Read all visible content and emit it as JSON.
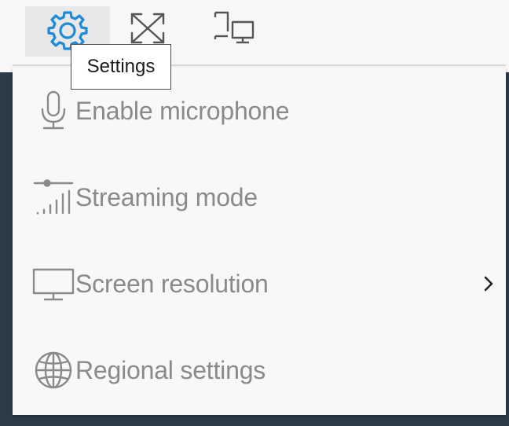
{
  "toolbar": {
    "buttons": [
      {
        "icon": "gear-icon",
        "active": true
      },
      {
        "icon": "fullscreen-icon",
        "active": false
      },
      {
        "icon": "display-switch-icon",
        "active": false
      }
    ],
    "accent_color": "#1f8ad6"
  },
  "tooltip": {
    "text": "Settings"
  },
  "menu": {
    "items": [
      {
        "label": "Enable microphone",
        "icon": "microphone-icon",
        "has_submenu": false
      },
      {
        "label": "Streaming mode",
        "icon": "signal-bars-icon",
        "has_submenu": false
      },
      {
        "label": "Screen resolution",
        "icon": "monitor-icon",
        "has_submenu": true,
        "chevron": "›"
      },
      {
        "label": "Regional settings",
        "icon": "globe-icon",
        "has_submenu": false
      }
    ],
    "label_color": "#8a8a8a"
  }
}
